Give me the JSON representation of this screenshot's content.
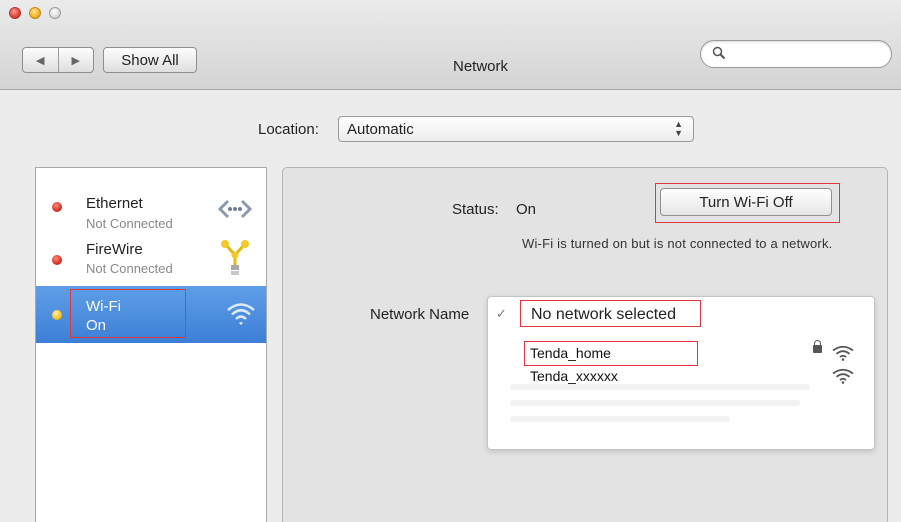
{
  "window": {
    "title": "Network"
  },
  "toolbar": {
    "show_all": "Show All",
    "back_icon": "back-arrow-icon",
    "forward_icon": "forward-arrow-icon",
    "search_icon": "search-icon"
  },
  "location": {
    "label": "Location:",
    "value": "Automatic"
  },
  "services": [
    {
      "name": "Ethernet",
      "status": "Not Connected",
      "dot": "red",
      "icon": "ethernet-icon"
    },
    {
      "name": "FireWire",
      "status": "Not Connected",
      "dot": "red",
      "icon": "firewire-icon"
    },
    {
      "name": "Wi-Fi",
      "status": "On",
      "dot": "yellow",
      "icon": "wifi-icon",
      "selected": true
    }
  ],
  "detail": {
    "status_label": "Status:",
    "status_value": "On",
    "turn_off_button": "Turn Wi-Fi Off",
    "description": "Wi-Fi is turned on but is not connected to a network.",
    "network_name_label": "Network Name",
    "selected_network": "No network selected",
    "networks": [
      {
        "name": "Tenda_home",
        "secured": true
      },
      {
        "name": "Tenda_xxxxxx",
        "secured": false
      }
    ]
  },
  "colors": {
    "highlight": "#e0383b",
    "selection": "#3d7fd6",
    "status_off": "#d32a1f",
    "status_on": "#f2bb1b"
  }
}
